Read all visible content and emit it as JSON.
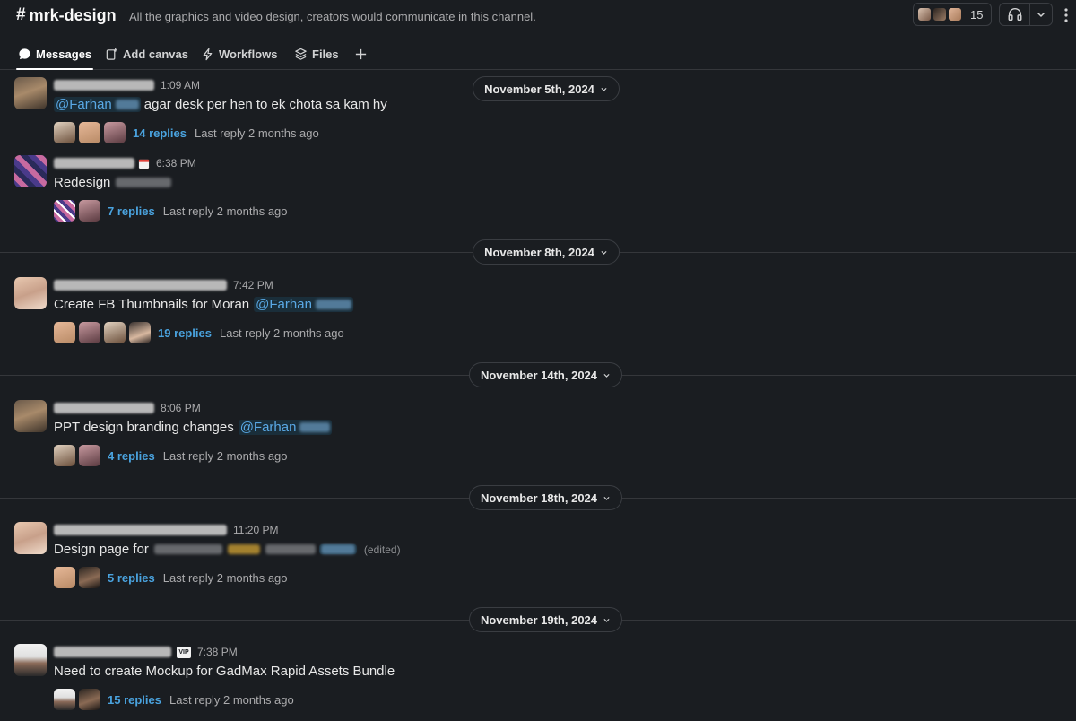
{
  "channel": {
    "name": "mrk-design",
    "description": "All the graphics and video design, creators would communicate in this channel.",
    "member_count": "15"
  },
  "tabs": [
    {
      "label": "Messages",
      "icon": "messages-icon",
      "active": true
    },
    {
      "label": "Add canvas",
      "icon": "canvas-icon"
    },
    {
      "label": "Workflows",
      "icon": "workflow-icon"
    },
    {
      "label": "Files",
      "icon": "files-icon"
    }
  ],
  "dates": [
    "November 5th, 2024",
    "November 8th, 2024",
    "November 14th, 2024",
    "November 18th, 2024",
    "November 19th, 2024"
  ],
  "messages": [
    {
      "time": "1:09 AM",
      "mention_prefix": "@Farhan",
      "text": "agar desk per hen to ek chota sa kam hy",
      "replies": "14 replies",
      "last_reply": "Last reply 2 months ago"
    },
    {
      "time": "6:38 PM",
      "text": "Redesign",
      "replies": "7 replies",
      "last_reply": "Last reply 2 months ago"
    },
    {
      "time": "7:42 PM",
      "text": "Create FB Thumbnails for Moran",
      "mention": "@Farhan",
      "replies": "19 replies",
      "last_reply": "Last reply 2 months ago"
    },
    {
      "time": "8:06 PM",
      "text": "PPT design branding changes",
      "mention": "@Farhan",
      "replies": "4 replies",
      "last_reply": "Last reply 2 months ago"
    },
    {
      "time": "11:20 PM",
      "text": "Design page for",
      "edited": "(edited)",
      "replies": "5 replies",
      "last_reply": "Last reply 2 months ago"
    },
    {
      "time": "7:38 PM",
      "badge": "VIP",
      "text": "Need to create Mockup for GadMax Rapid Assets Bundle",
      "replies": "15 replies",
      "last_reply": "Last reply 2 months ago"
    }
  ],
  "colors": {
    "background": "#1a1d21",
    "link": "#4aa3df",
    "mention": "#5aa9e6"
  }
}
